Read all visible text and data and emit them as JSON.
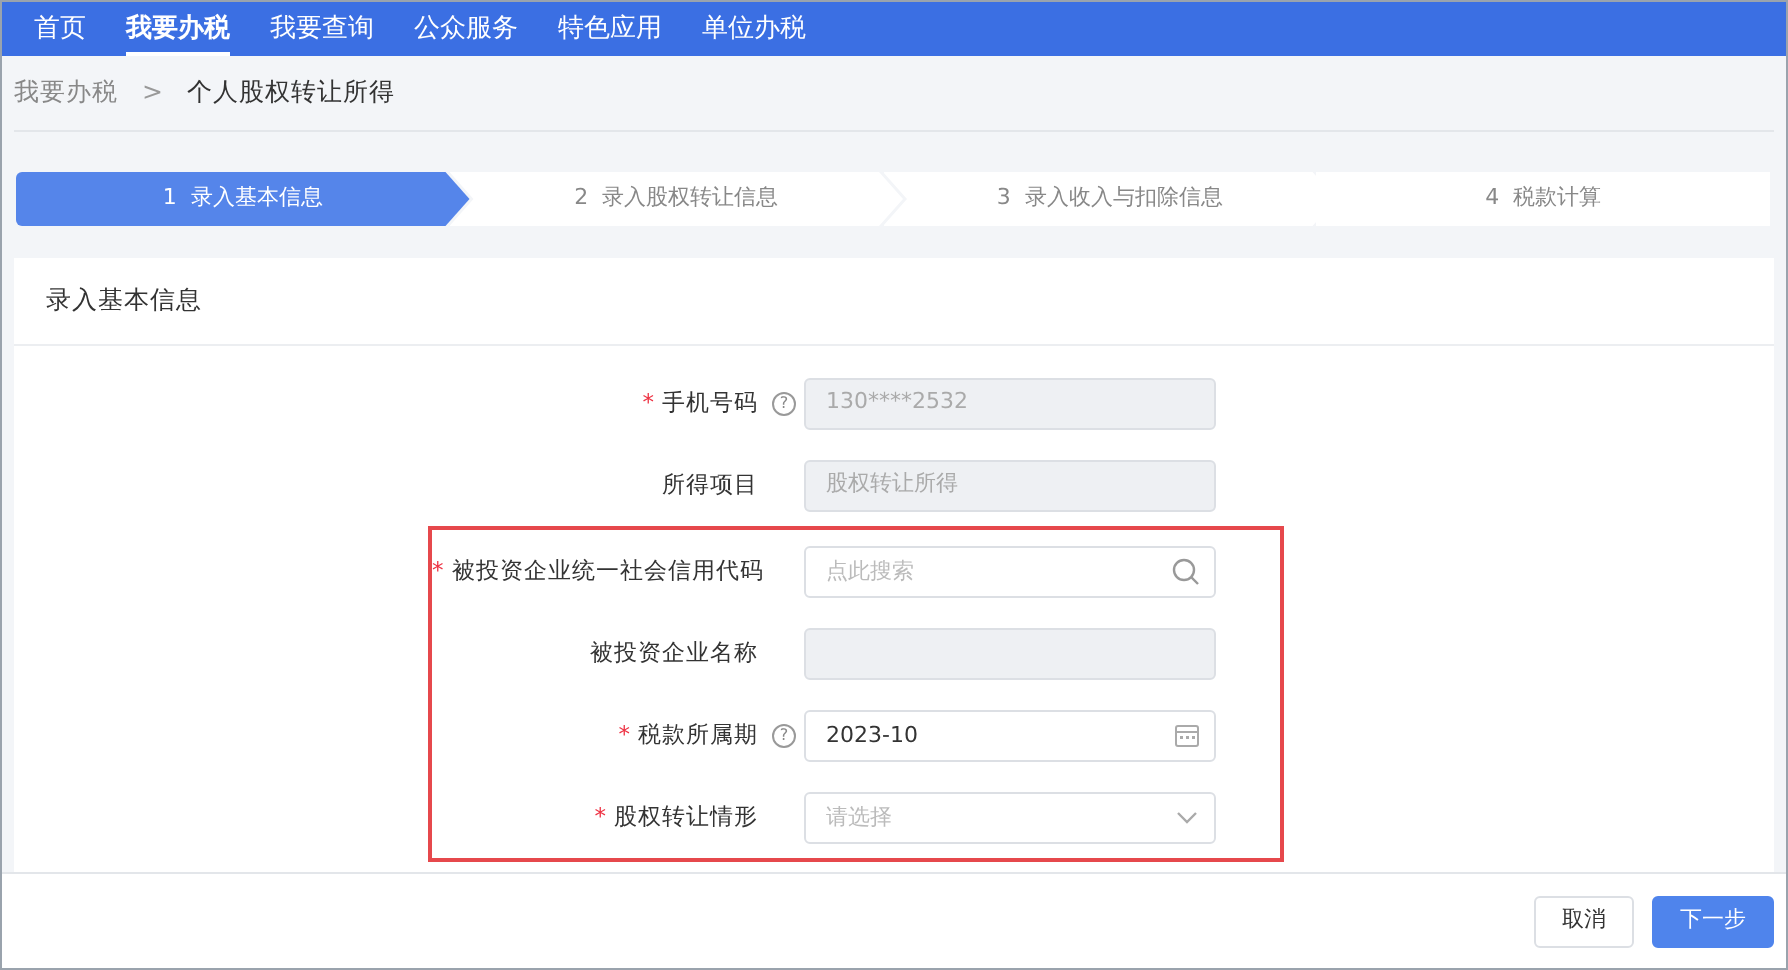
{
  "nav": [
    {
      "label": "首页",
      "selected": false
    },
    {
      "label": "我要办税",
      "selected": true
    },
    {
      "label": "我要查询",
      "selected": false
    },
    {
      "label": "公众服务",
      "selected": false
    },
    {
      "label": "特色应用",
      "selected": false
    },
    {
      "label": "单位办税",
      "selected": false
    }
  ],
  "breadcrumb": [
    {
      "label": "我要办税",
      "current": false
    },
    {
      "label": "个人股权转让所得",
      "current": true
    }
  ],
  "breadcrumb_separator": ">",
  "steps": [
    {
      "number": "1",
      "label": "录入基本信息",
      "selected": true
    },
    {
      "number": "2",
      "label": "录入股权转让信息",
      "selected": false
    },
    {
      "number": "3",
      "label": "录入收入与扣除信息",
      "selected": false
    },
    {
      "number": "4",
      "label": "税款计算",
      "selected": false
    }
  ],
  "section_title": "录入基本信息",
  "fields": [
    {
      "kind": "readonly",
      "label": "手机号码",
      "required": true,
      "help": true,
      "value": "130****2532",
      "highlighted": false
    },
    {
      "kind": "readonly",
      "label": "所得项目",
      "required": false,
      "help": false,
      "value": "股权转让所得",
      "highlighted": false
    },
    {
      "kind": "search",
      "label": "被投资企业统一社会信用代码",
      "required": true,
      "help": false,
      "placeholder": "点此搜索",
      "highlighted": true
    },
    {
      "kind": "readonly",
      "label": "被投资企业名称",
      "required": false,
      "help": false,
      "highlighted": true
    },
    {
      "kind": "date",
      "label": "税款所属期",
      "required": true,
      "help": true,
      "value": "2023-10",
      "highlighted": true
    },
    {
      "kind": "select",
      "label": "股权转让情形",
      "required": true,
      "help": false,
      "placeholder": "请选择",
      "highlighted": true
    }
  ],
  "required_mark": "*",
  "help_mark": "?",
  "buttons": [
    {
      "label": "取消",
      "kind": "secondary"
    },
    {
      "label": "下一步",
      "kind": "primary"
    }
  ]
}
